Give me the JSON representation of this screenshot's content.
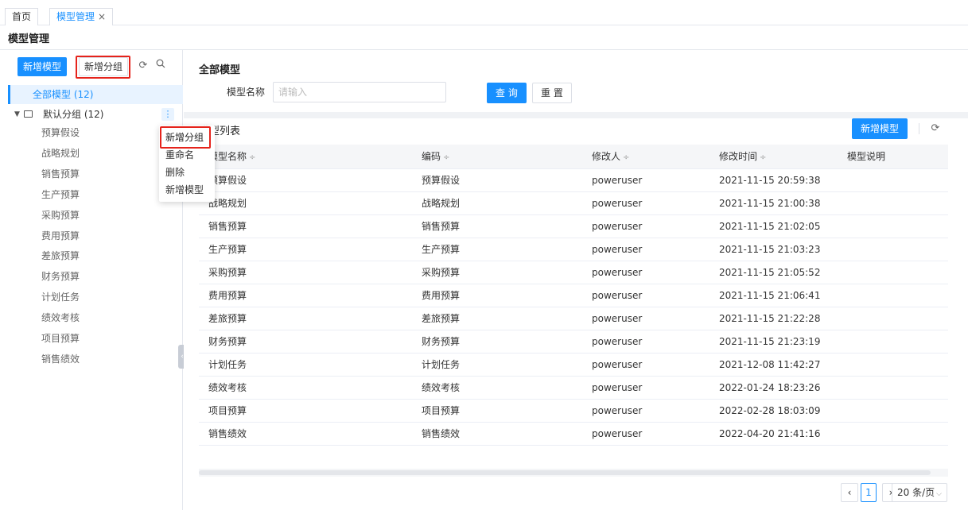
{
  "tabs": [
    {
      "label": "首页"
    },
    {
      "label": "模型管理",
      "close": "×"
    }
  ],
  "page_title": "模型管理",
  "sidebar": {
    "add_model_button": "新增模型",
    "add_group_button": "新增分组",
    "all_models": "全部模型 (12)",
    "group": {
      "label": "默认分组 (12)",
      "menu_icon": "⋮"
    },
    "items": [
      "预算假设",
      "战略规划",
      "销售预算",
      "生产预算",
      "采购预算",
      "费用预算",
      "差旅预算",
      "财务预算",
      "计划任务",
      "绩效考核",
      "项目预算",
      "销售绩效"
    ],
    "icons": {
      "refresh": "refresh-icon",
      "search": "search-icon"
    }
  },
  "context_menu": {
    "items": [
      "新增分组",
      "重命名",
      "删除",
      "新增模型"
    ],
    "highlighted_item": "新增分组"
  },
  "filter": {
    "title": "全部模型",
    "name_label": "模型名称",
    "name_placeholder": "请输入",
    "name_value": "",
    "query_button": "查 询",
    "reset_button": "重 置"
  },
  "list": {
    "title": "模型列表",
    "add_button": "新增模型",
    "columns": [
      "模型名称",
      "编码",
      "修改人",
      "修改时间",
      "模型说明"
    ],
    "sortable": [
      "模型名称",
      "编码",
      "修改人",
      "修改时间"
    ],
    "sort_icon": "÷",
    "rows": [
      {
        "name": "预算假设",
        "code": "预算假设",
        "modifier": "poweruser",
        "time": "2021-11-15 20:59:38",
        "desc": ""
      },
      {
        "name": "战略规划",
        "code": "战略规划",
        "modifier": "poweruser",
        "time": "2021-11-15 21:00:38",
        "desc": ""
      },
      {
        "name": "销售预算",
        "code": "销售预算",
        "modifier": "poweruser",
        "time": "2021-11-15 21:02:05",
        "desc": ""
      },
      {
        "name": "生产预算",
        "code": "生产预算",
        "modifier": "poweruser",
        "time": "2021-11-15 21:03:23",
        "desc": ""
      },
      {
        "name": "采购预算",
        "code": "采购预算",
        "modifier": "poweruser",
        "time": "2021-11-15 21:05:52",
        "desc": ""
      },
      {
        "name": "费用预算",
        "code": "费用预算",
        "modifier": "poweruser",
        "time": "2021-11-15 21:06:41",
        "desc": ""
      },
      {
        "name": "差旅预算",
        "code": "差旅预算",
        "modifier": "poweruser",
        "time": "2021-11-15 21:22:28",
        "desc": ""
      },
      {
        "name": "财务预算",
        "code": "财务预算",
        "modifier": "poweruser",
        "time": "2021-11-15 21:23:19",
        "desc": ""
      },
      {
        "name": "计划任务",
        "code": "计划任务",
        "modifier": "poweruser",
        "time": "2021-12-08 11:42:27",
        "desc": ""
      },
      {
        "name": "绩效考核",
        "code": "绩效考核",
        "modifier": "poweruser",
        "time": "2022-01-24 18:23:26",
        "desc": ""
      },
      {
        "name": "项目预算",
        "code": "项目预算",
        "modifier": "poweruser",
        "time": "2022-02-28 18:03:09",
        "desc": ""
      },
      {
        "name": "销售绩效",
        "code": "销售绩效",
        "modifier": "poweruser",
        "time": "2022-04-20 21:41:16",
        "desc": ""
      }
    ]
  },
  "pagination": {
    "prev": "‹",
    "current_page": "1",
    "next": "›",
    "page_size": "20 条/页"
  },
  "colors": {
    "primary": "#1890ff",
    "highlight_box": "#e5231b",
    "selected_bg": "#e8f3ff"
  }
}
